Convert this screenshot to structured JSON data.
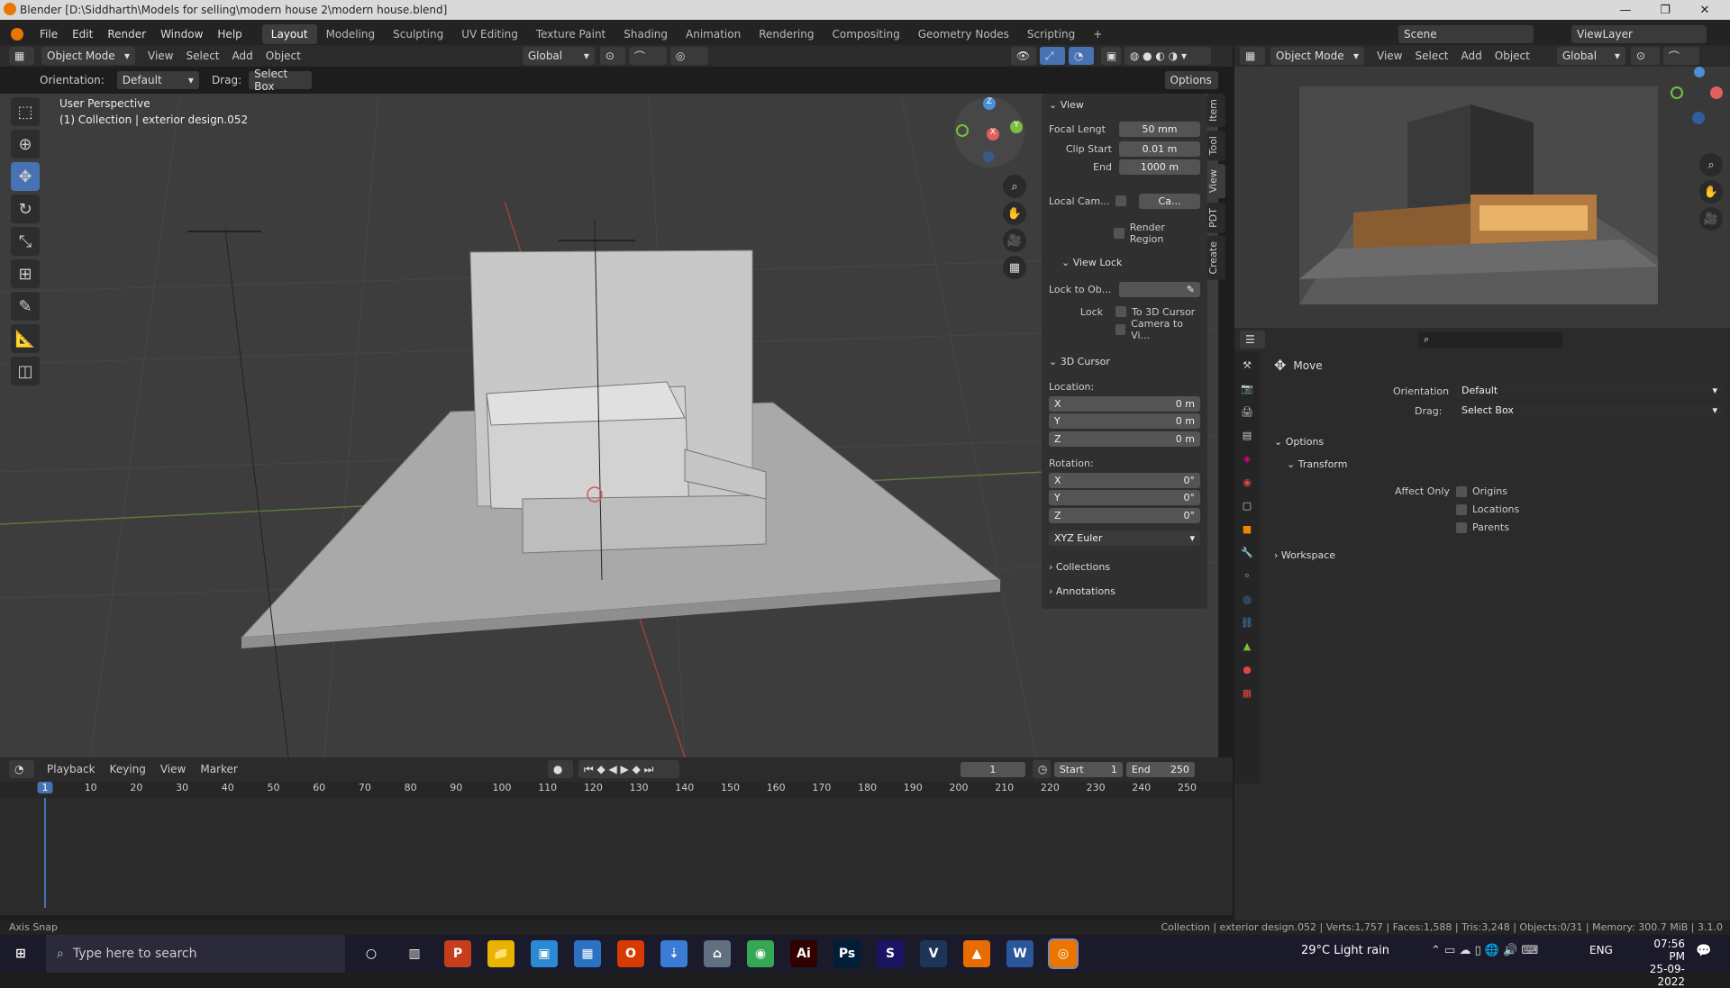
{
  "window": {
    "title": "Blender [D:\\Siddharth\\Models for selling\\modern house 2\\modern house.blend]",
    "minimize": "—",
    "maximize": "❐",
    "close": "✕"
  },
  "menu": {
    "items": [
      "File",
      "Edit",
      "Render",
      "Window",
      "Help"
    ],
    "workspaces": [
      "Layout",
      "Modeling",
      "Sculpting",
      "UV Editing",
      "Texture Paint",
      "Shading",
      "Animation",
      "Rendering",
      "Compositing",
      "Geometry Nodes",
      "Scripting",
      "+"
    ],
    "scene": "Scene",
    "viewlayer": "ViewLayer"
  },
  "viewport_header": {
    "mode": "Object Mode",
    "menus": [
      "View",
      "Select",
      "Add",
      "Object"
    ],
    "transform": "Global",
    "orientation_label": "Orientation:",
    "orientation_value": "Default",
    "drag_label": "Drag:",
    "drag_value": "Select Box",
    "options": "Options"
  },
  "viewport": {
    "perspective": "User Perspective",
    "collection": "(1) Collection | exterior design.052"
  },
  "npanel": {
    "view_header": "View",
    "focal_label": "Focal Lengt",
    "focal_value": "50 mm",
    "clip_start_label": "Clip Start",
    "clip_start_value": "0.01 m",
    "end_label": "End",
    "end_value": "1000 m",
    "local_cam_label": "Local Cam...",
    "local_cam_value": "Ca...",
    "render_region": "Render Region",
    "view_lock_header": "View Lock",
    "lock_to_label": "Lock to Ob...",
    "lock_label": "Lock",
    "to_3d_cursor": "To 3D Cursor",
    "camera_to_view": "Camera to Vi...",
    "cursor_header": "3D Cursor",
    "location_label": "Location:",
    "loc": [
      {
        "axis": "X",
        "value": "0 m"
      },
      {
        "axis": "Y",
        "value": "0 m"
      },
      {
        "axis": "Z",
        "value": "0 m"
      }
    ],
    "rotation_label": "Rotation:",
    "rot": [
      {
        "axis": "X",
        "value": "0°"
      },
      {
        "axis": "Y",
        "value": "0°"
      },
      {
        "axis": "Z",
        "value": "0°"
      }
    ],
    "rot_mode": "XYZ Euler",
    "collections": "Collections",
    "annotations": "Annotations",
    "tabs": [
      "Item",
      "Tool",
      "View",
      "PDT",
      "Create"
    ]
  },
  "timeline": {
    "menus": [
      "Playback",
      "Keying",
      "View",
      "Marker"
    ],
    "current_frame": "1",
    "start_label": "Start",
    "start": "1",
    "end_label": "End",
    "end": "250",
    "ticks": [
      "1",
      "10",
      "20",
      "30",
      "40",
      "50",
      "60",
      "70",
      "80",
      "90",
      "100",
      "110",
      "120",
      "130",
      "140",
      "150",
      "160",
      "170",
      "180",
      "190",
      "200",
      "210",
      "220",
      "230",
      "240",
      "250"
    ]
  },
  "status": {
    "left": "Axis Snap",
    "right": "Collection | exterior design.052 | Verts:1,757 | Faces:1,588 | Tris:3,248 | Objects:0/31 | Memory: 300.7 MiB | 3.1.0"
  },
  "right_viewport": {
    "mode": "Object Mode",
    "menus": [
      "View",
      "Select",
      "Add",
      "Object"
    ],
    "transform": "Global"
  },
  "properties": {
    "tool_name": "Move",
    "orientation_label": "Orientation",
    "orientation_value": "Default",
    "drag_label": "Drag:",
    "drag_value": "Select Box",
    "options_header": "Options",
    "transform_header": "Transform",
    "affect_only": "Affect Only",
    "origins": "Origins",
    "locations": "Locations",
    "parents": "Parents",
    "workspace": "Workspace"
  },
  "taskbar": {
    "search_placeholder": "Type here to search",
    "weather": "29°C  Light rain",
    "lang": "ENG",
    "time": "07:56 PM",
    "date": "25-09-2022",
    "apps": [
      {
        "name": "P",
        "color": "#c43e1c"
      },
      {
        "name": "📁",
        "color": "#e8b400"
      },
      {
        "name": "▣",
        "color": "#2a8ad4"
      },
      {
        "name": "▦",
        "color": "#2a72c4"
      },
      {
        "name": "O",
        "color": "#d83b01"
      },
      {
        "name": "⇣",
        "color": "#3a7bd5"
      },
      {
        "name": "⌂",
        "color": "#607080"
      },
      {
        "name": "◉",
        "color": "#34a853"
      },
      {
        "name": "Ai",
        "color": "#330000"
      },
      {
        "name": "Ps",
        "color": "#001e36"
      },
      {
        "name": "S",
        "color": "#1b1464"
      },
      {
        "name": "V",
        "color": "#1d3557"
      },
      {
        "name": "▲",
        "color": "#e86c00"
      },
      {
        "name": "W",
        "color": "#2b579a"
      },
      {
        "name": "◎",
        "color": "#ea7600"
      }
    ]
  },
  "colors": {
    "accent": "#4772b3",
    "x_axis": "#e06060",
    "y_axis": "#7cbf3a",
    "z_axis": "#4a90d9"
  }
}
